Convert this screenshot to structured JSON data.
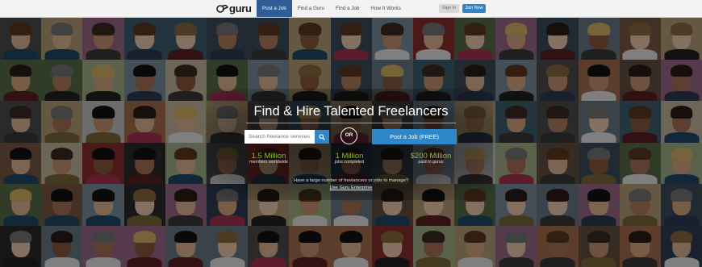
{
  "brand": {
    "logo_text": "guru"
  },
  "nav": {
    "items": [
      {
        "label": "Post a Job",
        "active": true
      },
      {
        "label": "Find a Guru",
        "active": false
      },
      {
        "label": "Find a Job",
        "active": false
      },
      {
        "label": "How It Works",
        "active": false
      }
    ],
    "sign_in_label": "Sign In",
    "join_label": "Join Now"
  },
  "hero": {
    "title": "Find & Hire Talented Freelancers",
    "search_placeholder": "Search freelance services",
    "or_label": "OR",
    "post_job_label": "Post a Job (FREE)",
    "stats": [
      {
        "value": "1.5 Million",
        "label": "members worldwide"
      },
      {
        "value": "1 Million",
        "label": "jobs completed"
      },
      {
        "value": "$200 Million",
        "label": "paid to gurus"
      }
    ],
    "enterprise_question": "Have a large number of freelancers or jobs to manage?",
    "enterprise_link": "Use Guru Enterprise"
  },
  "colors": {
    "accent_blue": "#2f86c9",
    "nav_active": "#2f5e96",
    "stat_green": "#8fb833"
  }
}
